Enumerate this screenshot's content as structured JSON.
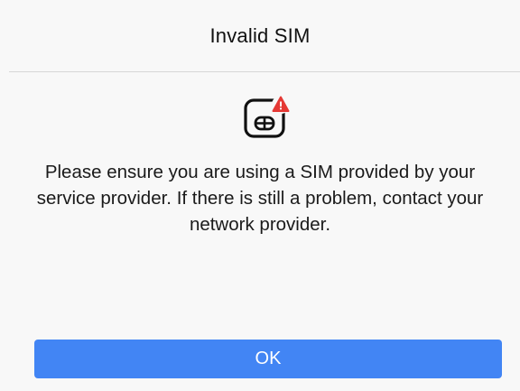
{
  "dialog": {
    "title": "Invalid SIM",
    "icon": "sim-card-error-icon",
    "message": "Please ensure you are using a SIM provided by your service provider. If there is still a problem, contact your network provider.",
    "ok_label": "OK"
  },
  "colors": {
    "accent": "#4285f4",
    "error_badge": "#e53935",
    "background": "#f8f8f8"
  }
}
